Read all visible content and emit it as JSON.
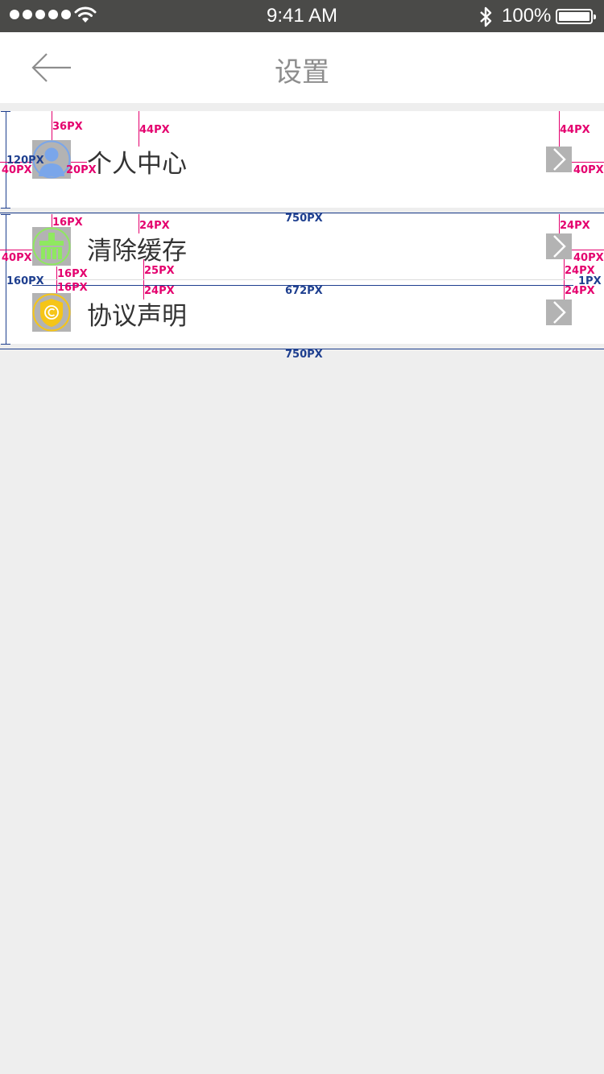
{
  "status_bar": {
    "time": "9:41 AM",
    "battery": "100%",
    "icons": [
      "signal-dots-icon",
      "wifi-icon",
      "bluetooth-icon",
      "battery-icon"
    ]
  },
  "nav": {
    "title": "设置",
    "back_icon": "arrow-left-icon"
  },
  "settings": {
    "items": [
      {
        "label": "个人中心",
        "icon": "user-icon",
        "color": "#7aa6ea"
      },
      {
        "label": "清除缓存",
        "icon": "broom-icon",
        "color": "#8fe860"
      },
      {
        "label": "协议声明",
        "icon": "copyright-shield-icon",
        "color": "#f5c518"
      }
    ]
  },
  "annotations": {
    "px36": "36PX",
    "px44": "44PX",
    "px120": "120PX",
    "px40": "40PX",
    "px20": "20PX",
    "px750": "750PX",
    "px16": "16PX",
    "px24": "24PX",
    "px25": "25PX",
    "px160": "160PX",
    "px672": "672PX",
    "px1": "1PX"
  },
  "colors": {
    "status_bar_bg": "#4a4a48",
    "page_bg": "#eeeeee",
    "annotation_pink": "#e4006e",
    "annotation_blue": "#1e3f8f",
    "icon_placeholder": "#b3b3b3"
  }
}
